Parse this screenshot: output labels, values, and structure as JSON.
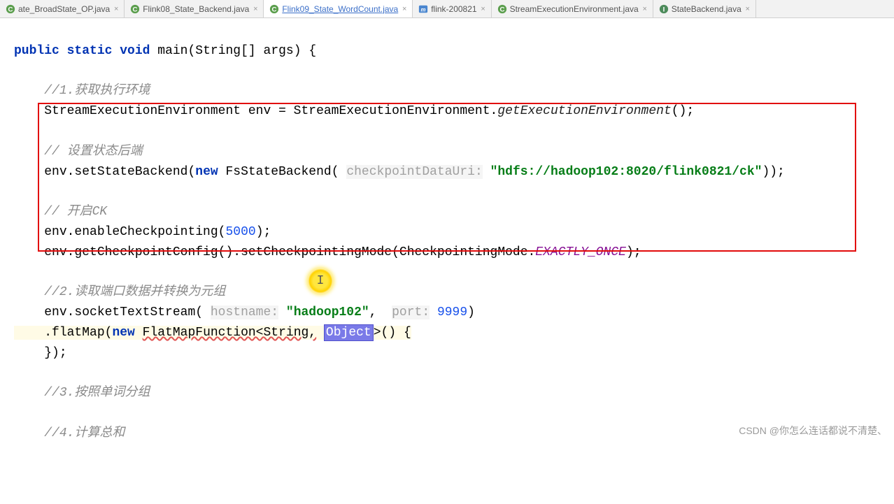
{
  "tabs": [
    {
      "label": "ate_BroadState_OP.java",
      "icon": "java-class",
      "active": false,
      "underline": false
    },
    {
      "label": "Flink08_State_Backend.java",
      "icon": "java-class",
      "active": false,
      "underline": false
    },
    {
      "label": "Flink09_State_WordCount.java",
      "icon": "java-class",
      "active": true,
      "underline": true
    },
    {
      "label": "flink-200821",
      "icon": "maven",
      "active": false,
      "underline": false
    },
    {
      "label": "StreamExecutionEnvironment.java",
      "icon": "java-class",
      "active": false,
      "underline": false
    },
    {
      "label": "StateBackend.java",
      "icon": "java-interface",
      "active": false,
      "underline": false
    }
  ],
  "code": {
    "l1_public": "public",
    "l1_static": "static",
    "l1_void": "void",
    "l1_main": "main",
    "l1_sig": "(String[] args) {",
    "c1": "//1.获取执行环境",
    "l3_a": "StreamExecutionEnvironment env = StreamExecutionEnvironment.",
    "l3_m": "getExecutionEnvironment",
    "l3_e": "();",
    "c2": "// 设置状态后端",
    "l5_a": "env.setStateBackend(",
    "l5_new": "new",
    "l5_b": " FsStateBackend( ",
    "l5_hint": "checkpointDataUri:",
    "l5_sp": " ",
    "l5_str": "\"hdfs://hadoop102:8020/flink0821/ck\"",
    "l5_e": "));",
    "c3": "// 开启CK",
    "l7_a": "env.enableCheckpointing(",
    "l7_num": "5000",
    "l7_e": ");",
    "l8_a": "env.getCheckpointConfig().setCheckpointingMode(CheckpointingMode.",
    "l8_c": "EXACTLY_ONCE",
    "l8_e": ");",
    "c4": "//2.读取端口数据并转换为元组",
    "l10_a": "env.socketTextStream( ",
    "l10_h1": "hostname:",
    "l10_sp1": " ",
    "l10_s1": "\"hadoop102\"",
    "l10_comma": ",  ",
    "l10_h2": "port:",
    "l10_sp2": " ",
    "l10_n": "9999",
    "l10_e": ")",
    "l11_a": ".flatMap(",
    "l11_new": "new",
    "l11_b": " ",
    "l11_fn": "FlatMapFunction<String,",
    "l11_sp": " ",
    "l11_obj": "Object",
    "l11_c": ">() {",
    "l12": "});",
    "c5": "//3.按照单词分组",
    "c6": "//4.计算总和"
  },
  "chart_data": {
    "checkpoint_uri": "hdfs://hadoop102:8020/flink0821/ck",
    "checkpoint_interval_ms": 5000,
    "checkpointing_mode": "EXACTLY_ONCE",
    "socket_host": "hadoop102",
    "socket_port": 9999
  },
  "watermark": "CSDN @你怎么连话都说不清楚、"
}
